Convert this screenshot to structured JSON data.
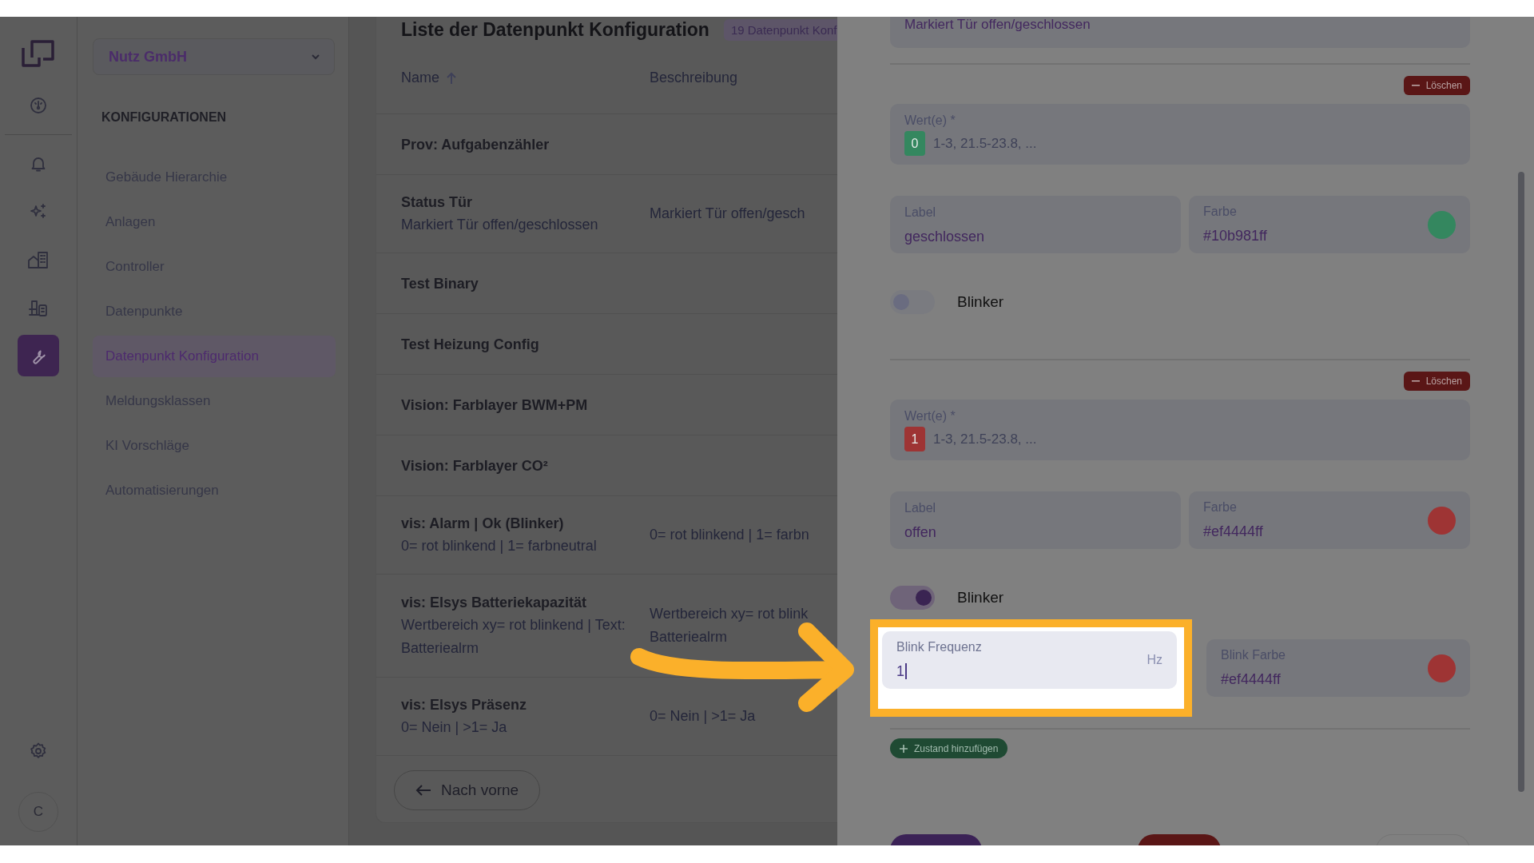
{
  "rail": {
    "items": [
      {
        "selected": false
      },
      {
        "selected": false
      },
      {
        "selected": false
      },
      {
        "selected": false
      },
      {
        "selected": false
      },
      {
        "selected": true
      }
    ],
    "avatar": "C"
  },
  "sidebar": {
    "company": "Nutz GmbH",
    "section": "KONFIGURATIONEN",
    "items": [
      {
        "label": "Gebäude Hierarchie",
        "selected": false
      },
      {
        "label": "Anlagen",
        "selected": false
      },
      {
        "label": "Controller",
        "selected": false
      },
      {
        "label": "Datenpunkte",
        "selected": false
      },
      {
        "label": "Datenpunkt Konfiguration",
        "selected": true
      },
      {
        "label": "Meldungsklassen",
        "selected": false
      },
      {
        "label": "KI Vorschläge",
        "selected": false
      },
      {
        "label": "Automatisierungen",
        "selected": false
      }
    ]
  },
  "list": {
    "title": "Liste der Datenpunkt Konfiguration",
    "badge": "19 Datenpunkt Konf",
    "columns": [
      "Name",
      "Beschreibung"
    ],
    "rows": [
      {
        "name": "Prov: Aufgabenzähler",
        "subtitle": [],
        "description": []
      },
      {
        "name": "Status Tür",
        "subtitle": [
          "Markiert Tür offen/geschlossen"
        ],
        "description": [
          "Markiert Tür offen/gesch"
        ]
      },
      {
        "name": "Test Binary",
        "subtitle": [],
        "description": []
      },
      {
        "name": "Test Heizung Config",
        "subtitle": [],
        "description": []
      },
      {
        "name": "Vision: Farblayer BWM+PM",
        "subtitle": [],
        "description": []
      },
      {
        "name": "Vision: Farblayer CO²",
        "subtitle": [],
        "description": []
      },
      {
        "name": "vis: Alarm | Ok (Blinker)",
        "subtitle": [
          "0= rot blinkend | 1= farbneutral"
        ],
        "description": [
          "0= rot blinkend | 1= farbn"
        ]
      },
      {
        "name": "vis: Elsys Batteriekapazität",
        "subtitle": [
          "Wertbereich xy= rot blinkend | Text:",
          "Batteriealrm"
        ],
        "description": [
          "Wertbereich xy= rot blink",
          "Batteriealrm"
        ]
      },
      {
        "name": "vis: Elsys Präsenz",
        "subtitle": [
          "0= Nein | >1= Ja"
        ],
        "description": [
          "0= Nein | >1= Ja"
        ]
      }
    ],
    "back_button": "Nach vorne"
  },
  "drawer": {
    "description_value": "Markiert Tür offen/geschlossen",
    "states": [
      {
        "delete": "Löschen",
        "values_label": "Wert(e) *",
        "chip": "0",
        "color": "#34875f",
        "values_placeholder": "1-3, 21.5-23.8, ...",
        "label_label": "Label",
        "label_value": "geschlossen",
        "color_label": "Farbe",
        "color_value": "#10b981ff",
        "blinker_label": "Blinker",
        "blinker_on": false
      },
      {
        "delete": "Löschen",
        "values_label": "Wert(e) *",
        "chip": "1",
        "color": "#9e3434",
        "values_placeholder": "1-3, 21.5-23.8, ...",
        "label_label": "Label",
        "label_value": "offen",
        "color_label": "Farbe",
        "color_value": "#ef4444ff",
        "blinker_label": "Blinker",
        "blinker_on": true,
        "blink": {
          "frequency_label": "Blink Frequenz",
          "frequency_value": "1",
          "unit": "Hz",
          "color_label": "Blink Farbe",
          "color_value": "#ef4444ff",
          "color": "#9e3434"
        }
      }
    ],
    "add_state": "Zustand hinzufügen"
  }
}
